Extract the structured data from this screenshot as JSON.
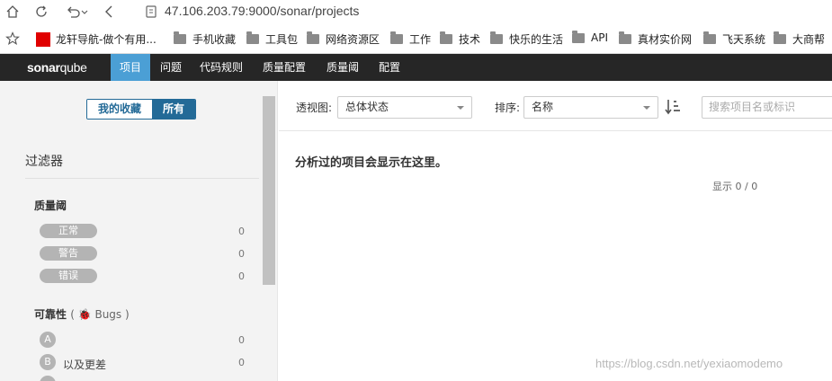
{
  "browser": {
    "url": "47.106.203.79:9000/sonar/projects",
    "bookmarks": [
      {
        "label": "龙轩导航-做个有用...",
        "icon": "red-square"
      },
      {
        "label": "手机收藏",
        "icon": "folder-icon"
      },
      {
        "label": "工具包",
        "icon": "folder-icon"
      },
      {
        "label": "网络资源区",
        "icon": "folder-icon"
      },
      {
        "label": "工作",
        "icon": "folder-icon"
      },
      {
        "label": "技术",
        "icon": "folder-icon"
      },
      {
        "label": "快乐的生活",
        "icon": "folder-icon"
      },
      {
        "label": "API",
        "icon": "folder-icon"
      },
      {
        "label": "真材实价网",
        "icon": "folder-icon"
      },
      {
        "label": "飞天系统",
        "icon": "folder-icon"
      },
      {
        "label": "大商帮",
        "icon": "folder-icon"
      }
    ]
  },
  "nav": {
    "logo_main": "sonar",
    "logo_accent": "qube",
    "items": [
      "项目",
      "问题",
      "代码规则",
      "质量配置",
      "质量阈",
      "配置"
    ],
    "active_index": 0
  },
  "sidebar": {
    "toggle": {
      "favorites": "我的收藏",
      "all": "所有"
    },
    "filters_title": "过滤器",
    "quality_gate": {
      "title": "质量阈",
      "items": [
        {
          "label": "正常",
          "count": "0"
        },
        {
          "label": "警告",
          "count": "0"
        },
        {
          "label": "错误",
          "count": "0"
        }
      ]
    },
    "reliability": {
      "title": "可靠性",
      "sub": "( 🐞 Bugs )",
      "items": [
        {
          "rating": "A",
          "label": "",
          "count": "0"
        },
        {
          "rating": "B",
          "label": "以及更差",
          "count": "0"
        }
      ]
    }
  },
  "main": {
    "view_label": "透视图:",
    "view_value": "总体状态",
    "sort_label": "排序:",
    "sort_value": "名称",
    "search_placeholder": "搜索项目名或标识",
    "empty_message": "分析过的项目会显示在这里。",
    "count_text": "显示 0 / 0"
  },
  "watermark": "https://blog.csdn.net/yexiaomodemo",
  "colors": {
    "topbar": "#262626",
    "active_nav": "#4b9fd5",
    "accent": "#236a97",
    "sidebar_bg": "#f3f3f3"
  }
}
